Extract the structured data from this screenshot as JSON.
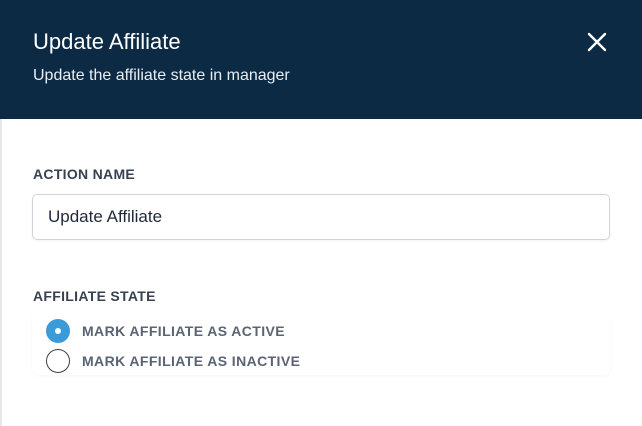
{
  "header": {
    "title": "Update Affiliate",
    "subtitle": "Update the affiliate state in manager",
    "close_icon": "close-icon"
  },
  "action_name": {
    "label": "ACTION NAME",
    "value": "Update Affiliate"
  },
  "affiliate_state": {
    "label": "AFFILIATE STATE",
    "options": [
      {
        "label": "MARK AFFILIATE AS ACTIVE",
        "selected": true
      },
      {
        "label": "MARK AFFILIATE AS INACTIVE",
        "selected": false
      }
    ]
  },
  "colors": {
    "header_bg": "#0c2a43",
    "radio_selected": "#3b9bd9"
  }
}
